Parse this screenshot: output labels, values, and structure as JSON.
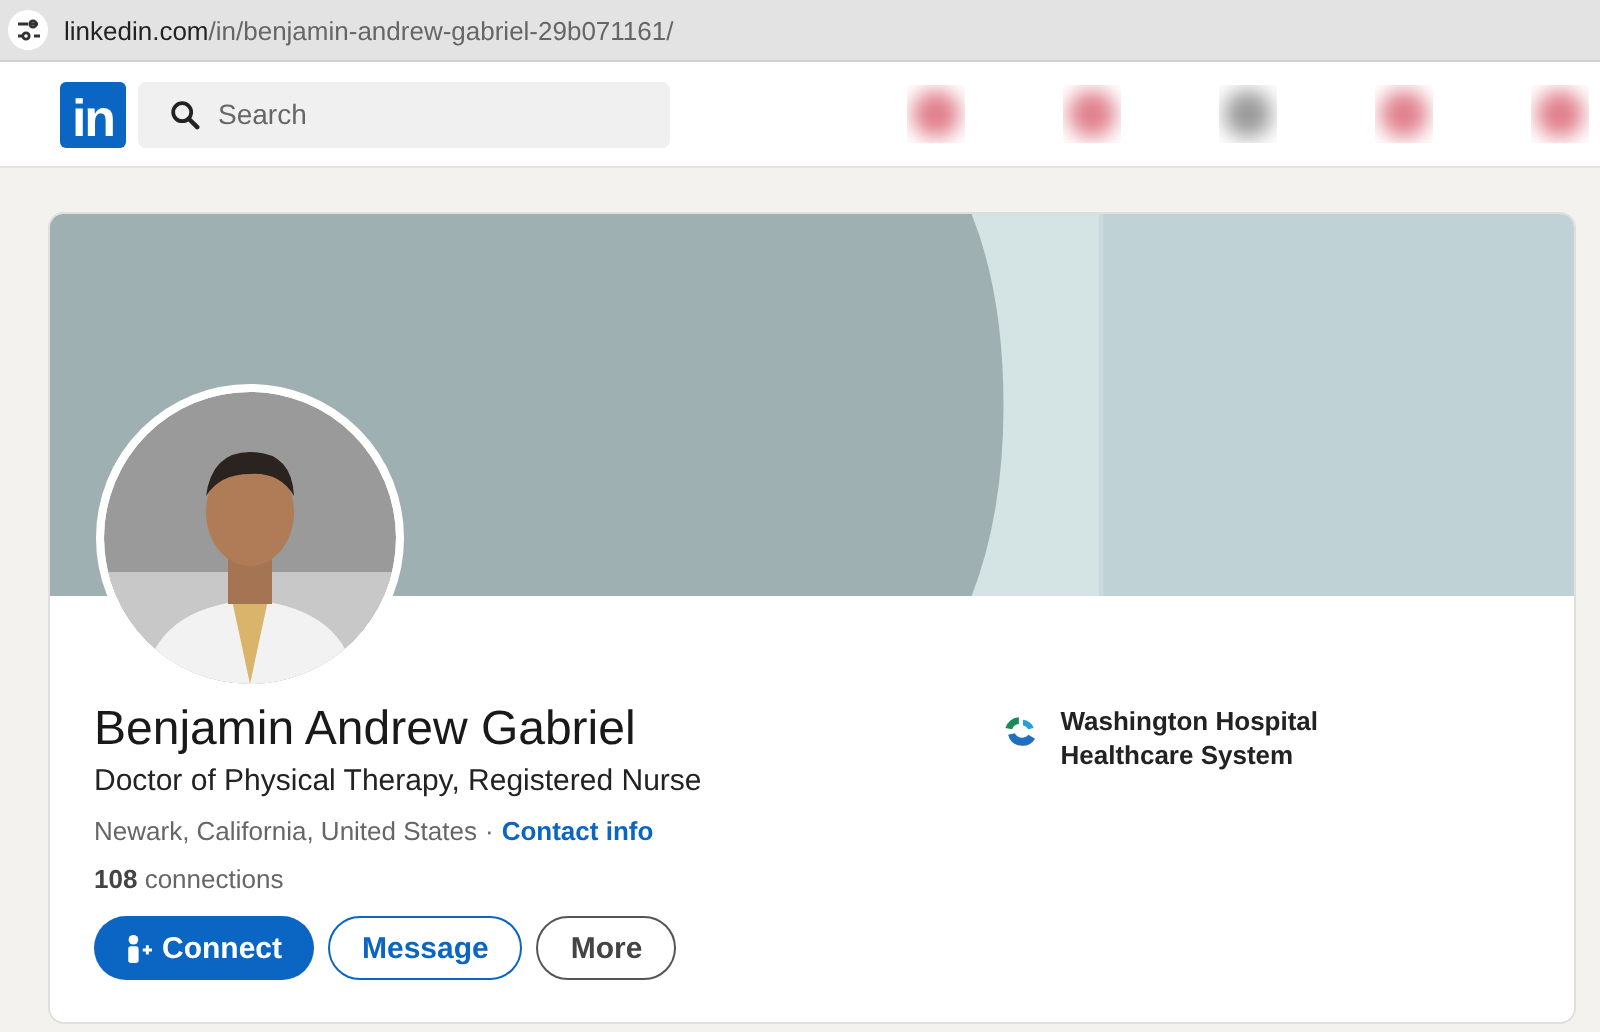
{
  "browser": {
    "url_host": "linkedin.com",
    "url_path": "/in/benjamin-andrew-gabriel-29b071161/"
  },
  "navbar": {
    "logo": "in",
    "search": {
      "placeholder": "Search"
    }
  },
  "profile": {
    "name": "Benjamin Andrew Gabriel",
    "headline": "Doctor of Physical Therapy, Registered Nurse",
    "location": "Newark, California, United States",
    "separator": "·",
    "contact_link": "Contact info",
    "connections": "**108** connections",
    "buttons": [
      {
        "label": "Connect",
        "kind": "primary"
      },
      {
        "label": "Message",
        "kind": "outline"
      },
      {
        "label": "More",
        "kind": "secondary"
      }
    ],
    "employer": {
      "name": "Washington Hospital Healthcare System"
    }
  }
}
